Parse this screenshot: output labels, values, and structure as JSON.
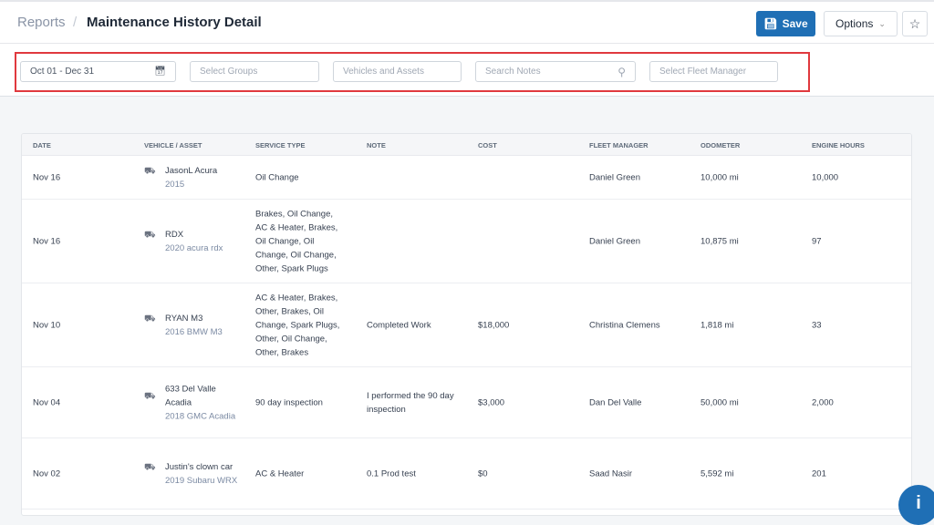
{
  "header": {
    "breadcrumb_root": "Reports",
    "separator": "/",
    "title": "Maintenance History Detail",
    "save_label": "Save",
    "options_label": "Options"
  },
  "filters": {
    "date_range": "Oct 01 - Dec 31",
    "groups_placeholder": "Select Groups",
    "vehicles_placeholder": "Vehicles and Assets",
    "notes_placeholder": "Search Notes",
    "manager_placeholder": "Select Fleet Manager"
  },
  "table": {
    "columns": [
      "DATE",
      "VEHICLE / ASSET",
      "SERVICE TYPE",
      "NOTE",
      "COST",
      "FLEET MANAGER",
      "ODOMETER",
      "ENGINE HOURS"
    ],
    "rows": [
      {
        "date": "Nov 16",
        "vehicle": "JasonL Acura",
        "vehicle_sub": "2015",
        "service": "Oil Change",
        "note": "",
        "cost": "",
        "manager": "Daniel Green",
        "odometer": "10,000 mi",
        "hours": "10,000"
      },
      {
        "date": "Nov 16",
        "vehicle": "RDX",
        "vehicle_sub": "2020 acura rdx",
        "service": "Brakes, Oil Change, AC & Heater, Brakes, Oil Change, Oil Change, Oil Change, Other, Spark Plugs",
        "note": "",
        "cost": "",
        "manager": "Daniel Green",
        "odometer": "10,875 mi",
        "hours": "97"
      },
      {
        "date": "Nov 10",
        "vehicle": "RYAN M3",
        "vehicle_sub": "2016 BMW M3",
        "service": "AC & Heater, Brakes, Other, Brakes, Oil Change, Spark Plugs, Other, Oil Change, Other, Brakes",
        "note": "Completed Work",
        "cost": "$18,000",
        "manager": "Christina Clemens",
        "odometer": "1,818 mi",
        "hours": "33"
      },
      {
        "date": "Nov 04",
        "vehicle": "633 Del Valle Acadia",
        "vehicle_sub": "2018 GMC Acadia",
        "service": "90 day inspection",
        "note": "I performed the 90 day inspection",
        "cost": "$3,000",
        "manager": "Dan Del Valle",
        "odometer": "50,000 mi",
        "hours": "2,000"
      },
      {
        "date": "Nov 02",
        "vehicle": "Justin's clown car",
        "vehicle_sub": "2019 Subaru WRX",
        "service": "AC & Heater",
        "note": "0.1 Prod test",
        "cost": "$0",
        "manager": "Saad Nasir",
        "odometer": "5,592 mi",
        "hours": "201"
      }
    ]
  },
  "info_label": "i",
  "colors": {
    "primary": "#1f6fb5",
    "highlight": "#e0393e"
  }
}
